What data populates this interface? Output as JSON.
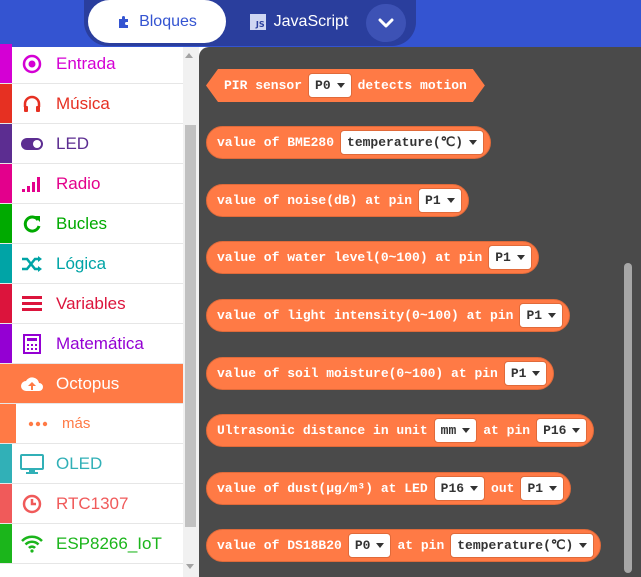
{
  "tabs": {
    "blocks_label": "Bloques",
    "js_label": "JavaScript",
    "js_badge": "JS"
  },
  "colors": {
    "topbar": "#3454D1",
    "flyout_bg": "#4A4A4A",
    "block": "#FF7A45"
  },
  "sidebar": {
    "items": [
      {
        "label": "Entrada",
        "color": "#D400D4",
        "icon": "target-icon"
      },
      {
        "label": "Música",
        "color": "#E63022",
        "icon": "headphones-icon"
      },
      {
        "label": "LED",
        "color": "#5C2D91",
        "icon": "toggle-icon"
      },
      {
        "label": "Radio",
        "color": "#E3008C",
        "icon": "signal-bars-icon"
      },
      {
        "label": "Bucles",
        "color": "#00AA00",
        "icon": "refresh-icon"
      },
      {
        "label": "Lógica",
        "color": "#00A4A6",
        "icon": "shuffle-icon"
      },
      {
        "label": "Variables",
        "color": "#DC143C",
        "icon": "list-icon"
      },
      {
        "label": "Matemática",
        "color": "#9400D3",
        "icon": "calculator-icon"
      },
      {
        "label": "Octopus",
        "color": "#FF7A45",
        "icon": "cloud-upload-icon"
      },
      {
        "label": "más",
        "color": "#FF7A45",
        "icon": "ellipsis-icon"
      },
      {
        "label": "OLED",
        "color": "#31B0B7",
        "icon": "monitor-icon"
      },
      {
        "label": "RTC1307",
        "color": "#F05A5A",
        "icon": "clock-icon"
      },
      {
        "label": "ESP8266_IoT",
        "color": "#1BB51B",
        "icon": "wifi-icon"
      }
    ]
  },
  "blocks": [
    {
      "pre": "PIR sensor",
      "dd1": "P0",
      "post": "detects motion"
    },
    {
      "pre": "value of BME280",
      "dd1": "temperature(℃)"
    },
    {
      "pre": "value of noise(dB) at pin",
      "dd1": "P1"
    },
    {
      "pre": "value of water level(0~100) at pin",
      "dd1": "P1"
    },
    {
      "pre": "value of light intensity(0~100) at pin",
      "dd1": "P1"
    },
    {
      "pre": "value of soil moisture(0~100) at pin",
      "dd1": "P1"
    },
    {
      "pre": "Ultrasonic distance in unit",
      "dd1": "mm",
      "mid": "at pin",
      "dd2": "P16"
    },
    {
      "pre": "value of dust(μg/m³) at LED",
      "dd1": "P16",
      "mid": "out",
      "dd2": "P1"
    },
    {
      "pre": "value of DS18B20",
      "dd1": "P0",
      "mid": "at pin",
      "dd2": "temperature(℃)"
    }
  ]
}
